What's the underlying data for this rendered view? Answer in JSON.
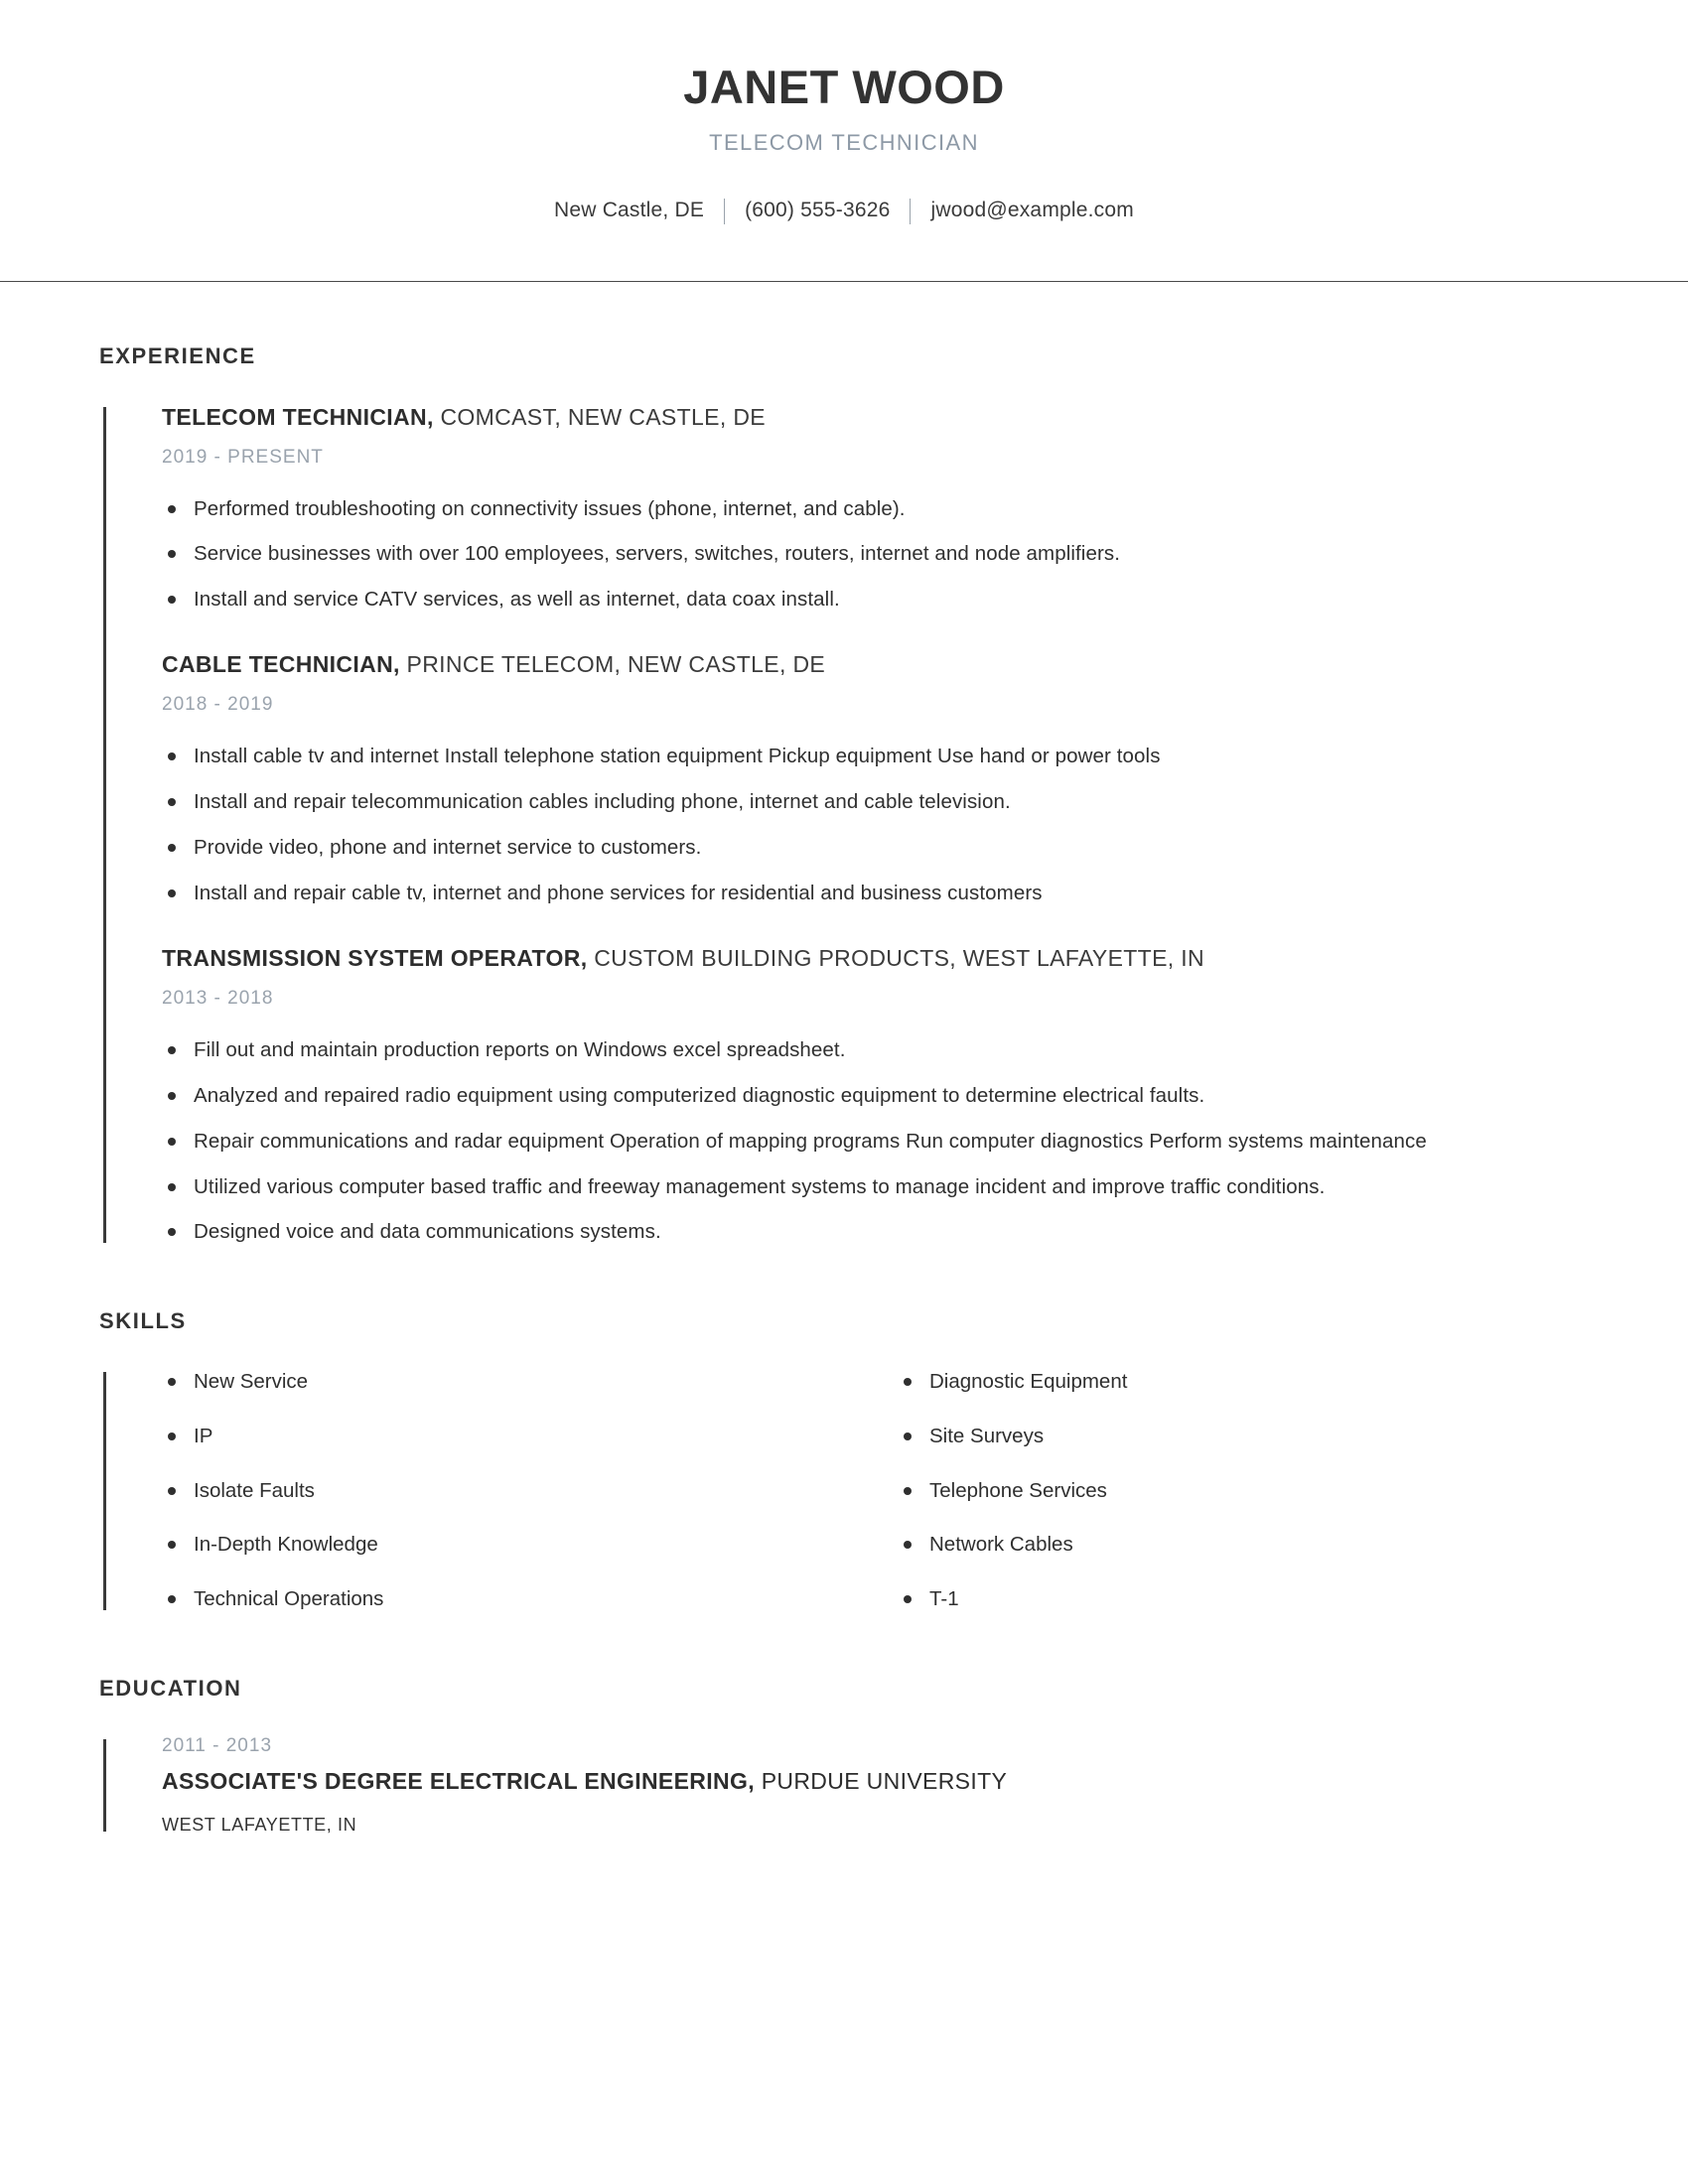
{
  "header": {
    "name": "JANET WOOD",
    "subtitle": "TELECOM TECHNICIAN",
    "contact": {
      "location": "New Castle, DE",
      "phone": "(600) 555-3626",
      "email": "jwood@example.com"
    }
  },
  "sections": {
    "experience_title": "EXPERIENCE",
    "skills_title": "SKILLS",
    "education_title": "EDUCATION"
  },
  "experience": [
    {
      "role": "TELECOM TECHNICIAN,",
      "org": " COMCAST, NEW CASTLE, DE",
      "dates": "2019 - PRESENT",
      "bullets": [
        "Performed troubleshooting on connectivity issues (phone, internet, and cable).",
        "Service businesses with over 100 employees, servers, switches, routers, internet and node amplifiers.",
        "Install and service CATV services, as well as internet, data coax install."
      ]
    },
    {
      "role": "CABLE TECHNICIAN,",
      "org": " PRINCE TELECOM, NEW CASTLE, DE",
      "dates": "2018 - 2019",
      "bullets": [
        "Install cable tv and internet Install telephone station equipment Pickup equipment Use hand or power tools",
        "Install and repair telecommunication cables including phone, internet and cable television.",
        "Provide video, phone and internet service to customers.",
        "Install and repair cable tv, internet and phone services for residential and business customers"
      ]
    },
    {
      "role": "TRANSMISSION SYSTEM OPERATOR,",
      "org": " CUSTOM BUILDING PRODUCTS, WEST LAFAYETTE, IN",
      "dates": "2013 - 2018",
      "bullets": [
        "Fill out and maintain production reports on Windows excel spreadsheet.",
        "Analyzed and repaired radio equipment using computerized diagnostic equipment to determine electrical faults.",
        "Repair communications and radar equipment Operation of mapping programs Run computer diagnostics Perform systems maintenance",
        "Utilized various computer based traffic and freeway management systems to manage incident and improve traffic conditions.",
        "Designed voice and data communications systems."
      ]
    }
  ],
  "skills": {
    "left": [
      "New Service",
      "IP",
      "Isolate Faults",
      "In-Depth Knowledge",
      "Technical Operations"
    ],
    "right": [
      "Diagnostic Equipment",
      "Site Surveys",
      "Telephone Services",
      "Network Cables",
      "T-1"
    ]
  },
  "education": [
    {
      "dates": "2011 - 2013",
      "degree": "ASSOCIATE'S DEGREE ELECTRICAL ENGINEERING,",
      "school": " PURDUE UNIVERSITY",
      "location": "WEST LAFAYETTE, IN"
    }
  ],
  "colors": {
    "text": "#2e2e2e",
    "muted": "#9aa3ad",
    "subtitle": "#8d99a6",
    "rule": "#4a4a4a",
    "accent_bar": "#3a3a3a"
  }
}
